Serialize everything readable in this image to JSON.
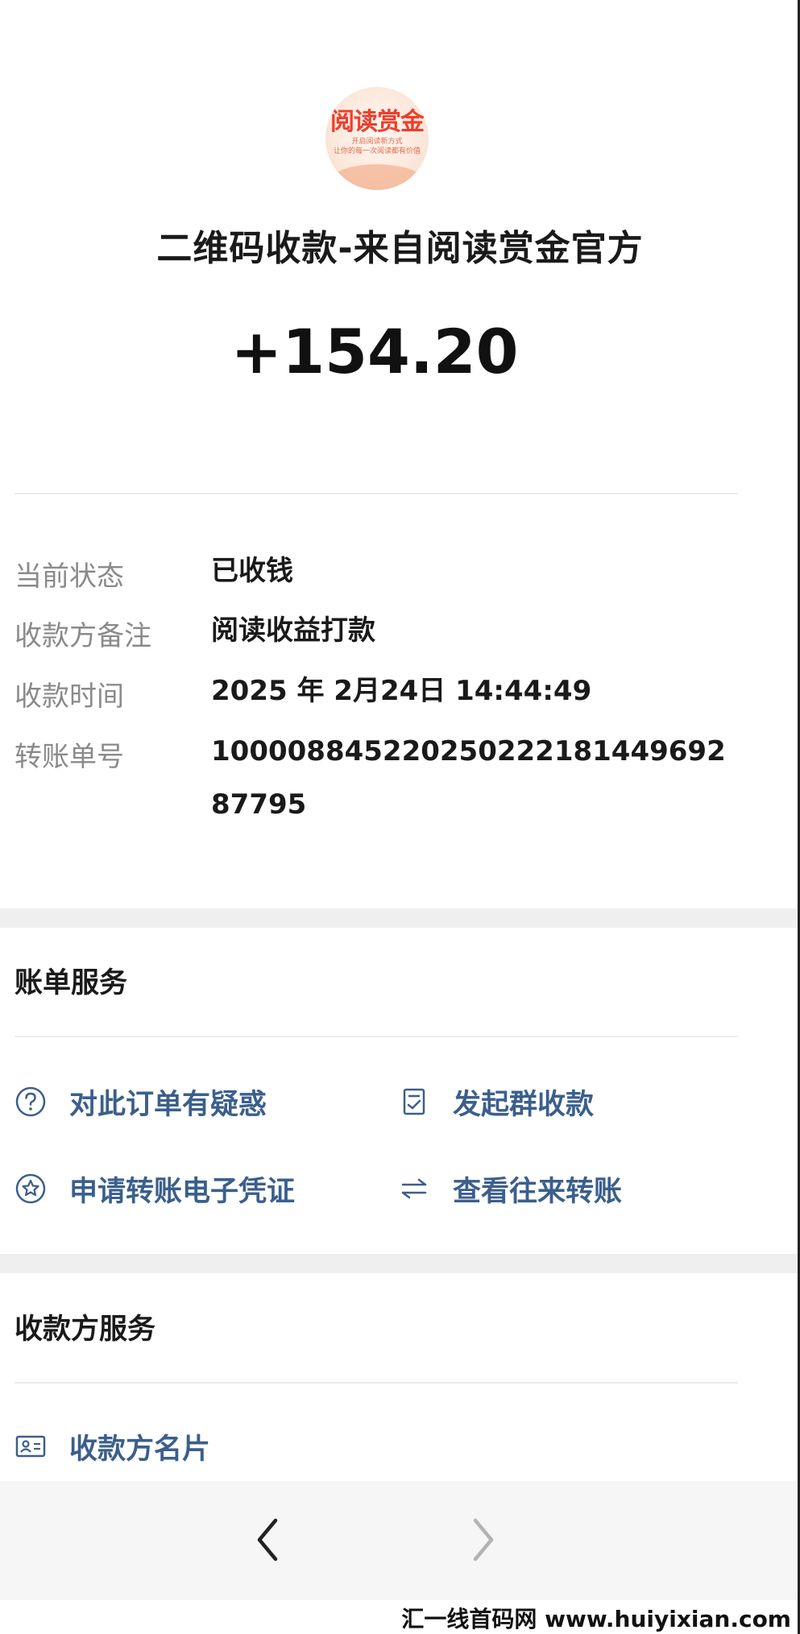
{
  "header": {
    "logo_title": "阅读赏金",
    "logo_subtitle": "开启阅读新方式\n让你的每一次阅读都有价值",
    "title": "二维码收款-来自阅读赏金官方",
    "amount": "+154.20"
  },
  "details": [
    {
      "label": "当前状态",
      "value": "已收钱"
    },
    {
      "label": "收款方备注",
      "value": "阅读收益打款"
    },
    {
      "label": "收款时间",
      "value": "2025 年 2月24日 14:44:49"
    },
    {
      "label": "转账单号",
      "value": "100008845220250222181449692 87795"
    }
  ],
  "bill_services": {
    "title": "账单服务",
    "items": [
      {
        "label": "对此订单有疑惑",
        "icon": "question-circle-icon"
      },
      {
        "label": "发起群收款",
        "icon": "checklist-doc-icon"
      },
      {
        "label": "申请转账电子凭证",
        "icon": "star-circle-icon"
      },
      {
        "label": "查看往来转账",
        "icon": "swap-arrows-icon"
      }
    ]
  },
  "payee_services": {
    "title": "收款方服务",
    "items": [
      {
        "label": "收款方名片",
        "icon": "id-card-icon"
      }
    ]
  },
  "nav": {
    "back_icon": "chevron-left-icon",
    "forward_icon": "chevron-right-icon"
  },
  "watermark": "汇一线首码网 www.huiyixian.com",
  "colors": {
    "link": "#3b5f8c",
    "label_gray": "#8a8a8a",
    "band_gray": "#efefef",
    "logo_red": "#ef3d2b"
  }
}
